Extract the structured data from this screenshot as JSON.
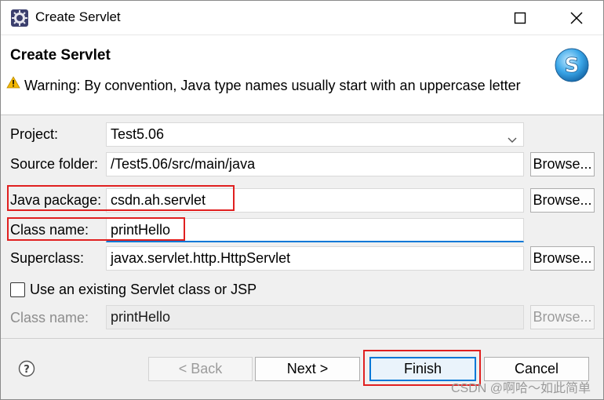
{
  "window": {
    "title": "Create Servlet",
    "icon": "eclipse-icon",
    "controls": {
      "maximize": "maximize-icon",
      "close": "close-icon"
    }
  },
  "header": {
    "title": "Create Servlet",
    "warning": "Warning: By convention, Java type names usually start with an uppercase letter",
    "icon": "servlet-wizard-icon"
  },
  "form": {
    "project": {
      "label": "Project:",
      "value": "Test5.06"
    },
    "source_folder": {
      "label": "Source folder:",
      "value": "/Test5.06/src/main/java",
      "browse": "Browse..."
    },
    "java_package": {
      "label": "Java package:",
      "value": "csdn.ah.servlet",
      "browse": "Browse..."
    },
    "class_name": {
      "label": "Class name:",
      "value": "printHello"
    },
    "superclass": {
      "label": "Superclass:",
      "value": "javax.servlet.http.HttpServlet",
      "browse": "Browse..."
    },
    "use_existing": {
      "label": "Use an existing Servlet class or JSP",
      "checked": false
    },
    "existing_class_name": {
      "label": "Class name:",
      "value": "printHello",
      "browse": "Browse..."
    }
  },
  "buttons": {
    "back": "< Back",
    "next": "Next >",
    "finish": "Finish",
    "cancel": "Cancel"
  },
  "watermark": "CSDN @啊哈～如此简单",
  "colors": {
    "highlight_box": "#e02020",
    "focus_accent": "#0078d7",
    "warning": "#f5b800"
  }
}
